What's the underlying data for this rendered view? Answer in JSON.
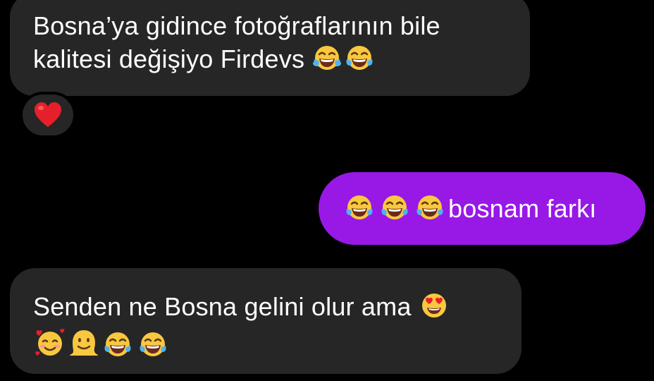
{
  "messages": [
    {
      "sender": "incoming",
      "lines": [
        {
          "text": "Bosna’ya gidince fotoğraflarının bile",
          "emojis": []
        },
        {
          "text": "kalitesi değişiyo Firdevs ",
          "emojis": [
            "face-with-tears-of-joy-icon",
            "face-with-tears-of-joy-icon"
          ]
        }
      ],
      "reaction": "red-heart-icon"
    },
    {
      "sender": "outgoing",
      "emojis_before": [
        "face-with-tears-of-joy-icon",
        "face-with-tears-of-joy-icon",
        "face-with-tears-of-joy-icon"
      ],
      "text": "bosnam farkı"
    },
    {
      "sender": "incoming",
      "lines": [
        {
          "text": "Senden ne Bosna gelini olur ama ",
          "emojis": [
            "heart-eyes-icon"
          ]
        },
        {
          "text": "",
          "emojis": [
            "smiling-face-with-hearts-icon",
            "melting-face-icon",
            "face-with-tears-of-joy-icon",
            "face-with-tears-of-joy-icon"
          ]
        }
      ]
    }
  ],
  "colors": {
    "background": "#000000",
    "incoming_bubble": "#262626",
    "outgoing_bubble": "#9818e6",
    "text": "#ffffff"
  }
}
